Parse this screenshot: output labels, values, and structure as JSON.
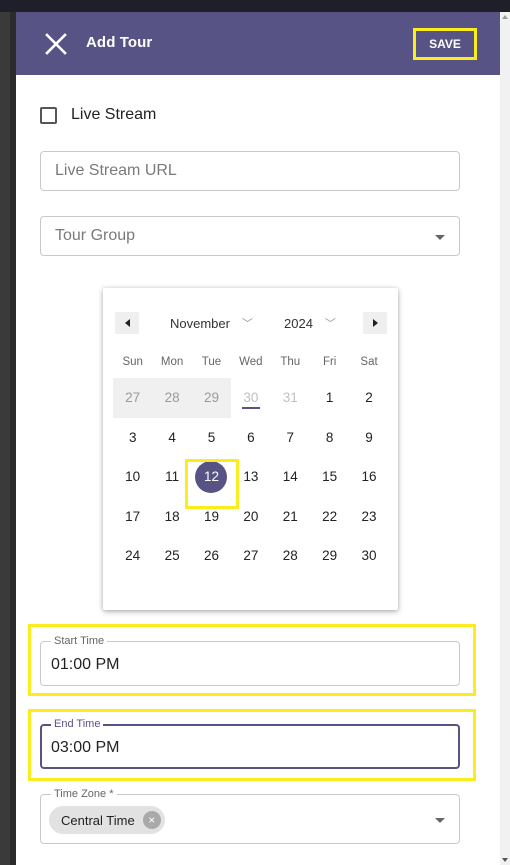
{
  "appbar": {
    "title": "Add Tour",
    "save_label": "SAVE",
    "close_icon": "close-icon"
  },
  "form": {
    "live_stream_label": "Live Stream",
    "live_stream_checked": false,
    "live_stream_url_placeholder": "Live Stream URL",
    "tour_group_placeholder": "Tour Group",
    "start_time_label": "Start Time",
    "start_time_value": "01:00 PM",
    "end_time_label": "End Time",
    "end_time_value": "03:00 PM",
    "time_zone_label": "Time Zone *",
    "time_zone_chip": "Central Time"
  },
  "calendar": {
    "month": "November",
    "year": "2024",
    "weekdays": [
      "Sun",
      "Mon",
      "Tue",
      "Wed",
      "Thu",
      "Fri",
      "Sat"
    ],
    "weeks": [
      [
        "27",
        "28",
        "29",
        "30",
        "31",
        "1",
        "2"
      ],
      [
        "3",
        "4",
        "5",
        "6",
        "7",
        "8",
        "9"
      ],
      [
        "10",
        "11",
        "12",
        "13",
        "14",
        "15",
        "16"
      ],
      [
        "17",
        "18",
        "19",
        "20",
        "21",
        "22",
        "23"
      ],
      [
        "24",
        "25",
        "26",
        "27",
        "28",
        "29",
        "30"
      ]
    ],
    "selected_day": "12"
  },
  "colors": {
    "primary": "#585385",
    "highlight": "#fbec1d"
  }
}
